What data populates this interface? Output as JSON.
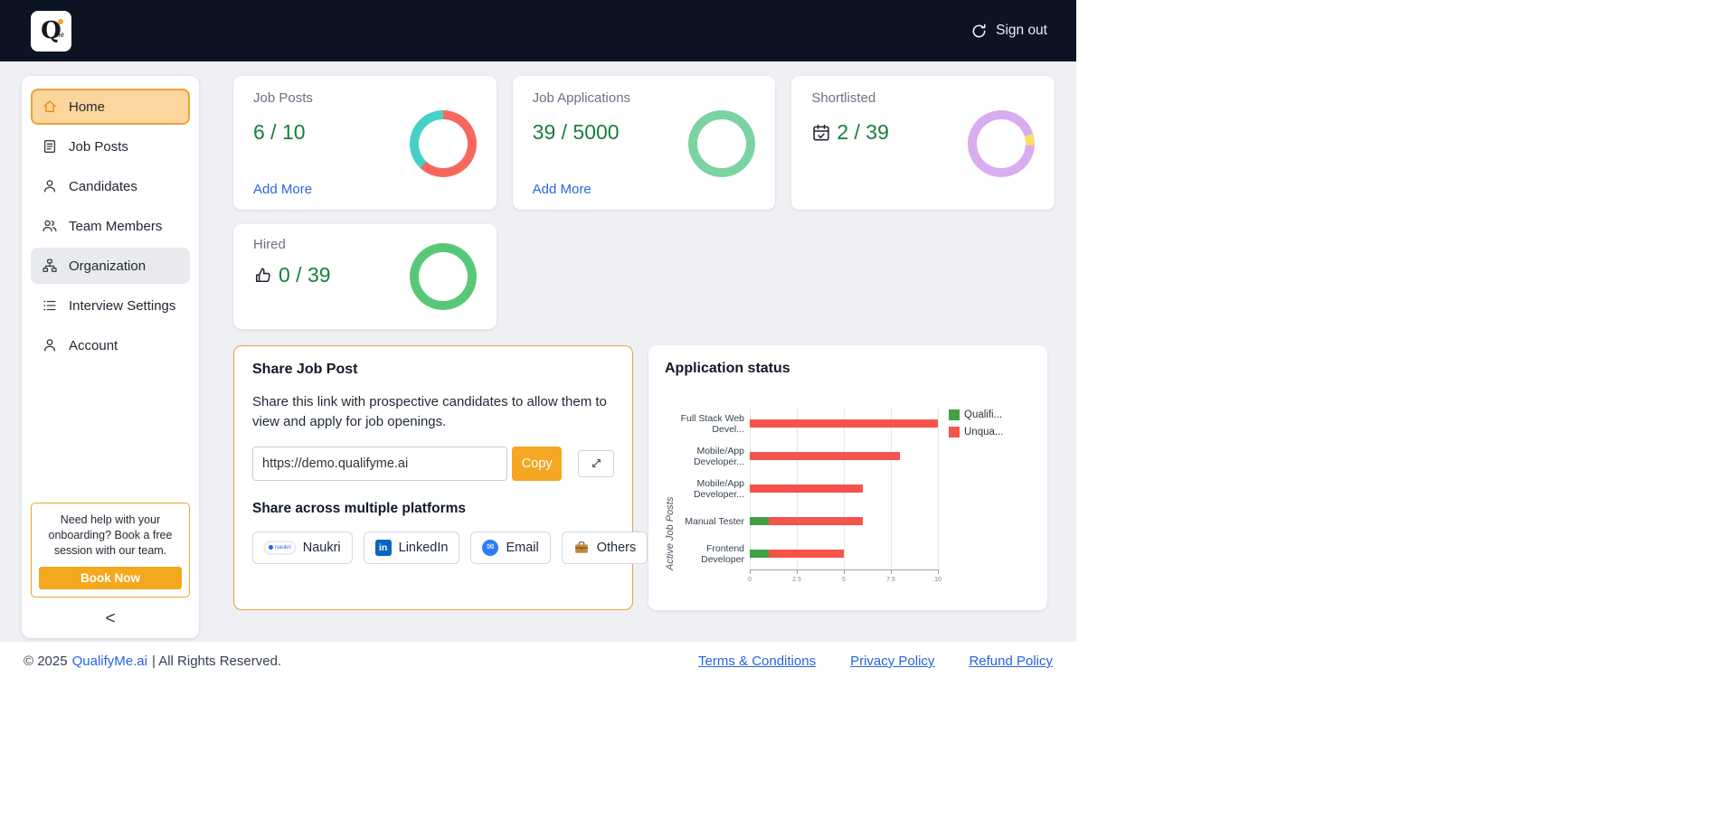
{
  "navbar": {
    "logo_q": "Q",
    "logo_me": "me",
    "signout_label": "Sign out"
  },
  "sidebar": {
    "items": [
      {
        "label": "Home"
      },
      {
        "label": "Job Posts"
      },
      {
        "label": "Candidates"
      },
      {
        "label": "Team Members"
      },
      {
        "label": "Organization"
      },
      {
        "label": "Interview Settings"
      },
      {
        "label": "Account"
      }
    ],
    "help_text": "Need help with your onboarding? Book a free session with our team.",
    "book_now_label": "Book Now",
    "collapse_label": "<"
  },
  "stats": [
    {
      "title": "Job Posts",
      "value": "6 / 10",
      "link_label": "Add More",
      "donut": {
        "segments": [
          {
            "color": "#f6685e",
            "pct": 62
          },
          {
            "color": "#45d1c5",
            "pct": 38
          }
        ]
      }
    },
    {
      "title": "Job Applications",
      "value": "39 / 5000",
      "link_label": "Add More",
      "donut": {
        "segments": [
          {
            "color": "#7bd3a2",
            "pct": 100
          }
        ]
      }
    },
    {
      "title": "Shortlisted",
      "value": "2 / 39",
      "donut": {
        "segments": [
          {
            "color": "#d9abef",
            "pct": 20
          },
          {
            "color": "#f7dc6f",
            "pct": 6
          },
          {
            "color": "#d9abef",
            "pct": 74
          }
        ]
      }
    },
    {
      "title": "Hired",
      "value": "0 / 39",
      "donut": {
        "segments": [
          {
            "color": "#58c878",
            "pct": 100
          }
        ]
      }
    }
  ],
  "share": {
    "title": "Share Job Post",
    "description": "Share this link with prospective candidates to allow them to view and apply for job openings.",
    "url": "https://demo.qualifyme.ai",
    "copy_label": "Copy",
    "platforms_title": "Share across multiple platforms",
    "naukri_glyph": "naukri",
    "linkedin_glyph": "in",
    "email_glyph": "✉",
    "platforms": [
      {
        "label": "Naukri"
      },
      {
        "label": "LinkedIn"
      },
      {
        "label": "Email"
      },
      {
        "label": "Others"
      }
    ]
  },
  "chart_data": {
    "type": "bar",
    "orientation": "horizontal",
    "title": "Application status",
    "ylabel": "Active Job Posts",
    "categories": [
      "Full Stack Web Devel...",
      "Mobile/App Developer...",
      "Mobile/App Developer...",
      "Manual Tester",
      "Frontend Developer"
    ],
    "series": [
      {
        "name": "Qualifi...",
        "color": "#43a047",
        "values": [
          0,
          0,
          0,
          1,
          1
        ]
      },
      {
        "name": "Unqua...",
        "color": "#f4544c",
        "values": [
          10,
          8,
          6,
          5,
          4
        ]
      }
    ],
    "xlim": [
      0,
      10
    ],
    "xticks": [
      0,
      2.5,
      5,
      7.5,
      10
    ],
    "legend_position": "right",
    "grid": true
  },
  "footer": {
    "copyright_prefix": "© 2025",
    "brand": "QualifyMe.ai",
    "copyright_suffix": "| All Rights Reserved.",
    "links": [
      {
        "label": "Terms & Conditions"
      },
      {
        "label": "Privacy Policy"
      },
      {
        "label": "Refund Policy"
      }
    ]
  }
}
